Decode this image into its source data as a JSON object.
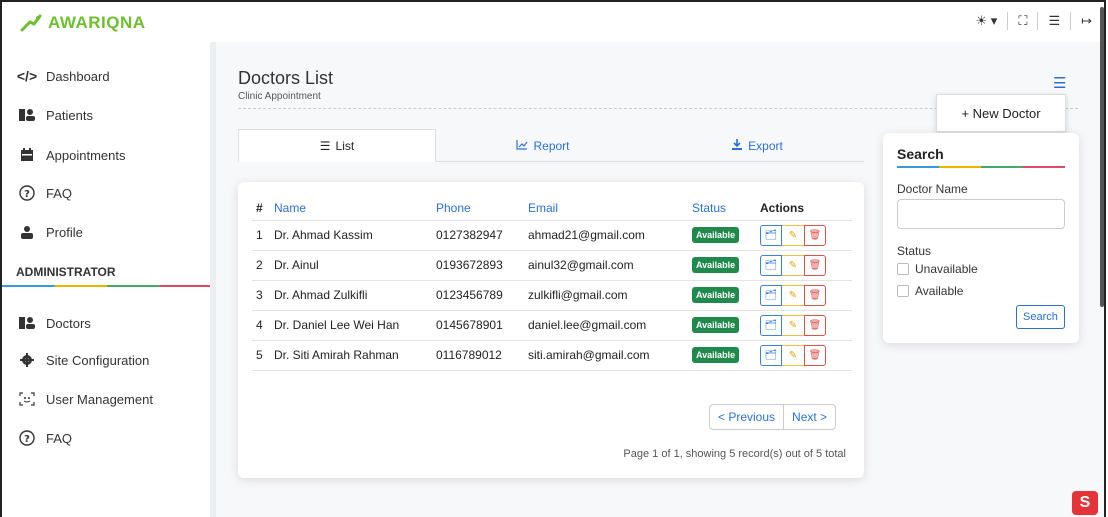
{
  "brand": {
    "name": "AWARIQNA"
  },
  "topbar": {
    "theme_icon": "sun-icon",
    "fullscreen_icon": "fullscreen-icon",
    "menu_icon": "list-icon",
    "logout_icon": "logout-icon"
  },
  "sidebar": {
    "items": [
      {
        "label": "Dashboard",
        "icon": "code-icon"
      },
      {
        "label": "Patients",
        "icon": "users-icon"
      },
      {
        "label": "Appointments",
        "icon": "calendar-icon"
      },
      {
        "label": "FAQ",
        "icon": "question-icon"
      },
      {
        "label": "Profile",
        "icon": "user-icon"
      }
    ],
    "admin_heading": "ADMINISTRATOR",
    "admin_items": [
      {
        "label": "Doctors",
        "icon": "users-icon"
      },
      {
        "label": "Site Configuration",
        "icon": "gear-icon"
      },
      {
        "label": "User Management",
        "icon": "face-scan-icon"
      },
      {
        "label": "FAQ",
        "icon": "question-icon"
      }
    ]
  },
  "page": {
    "title": "Doctors List",
    "subtitle": "Clinic Appointment"
  },
  "new_doctor_button": "+ New Doctor",
  "tabs": [
    {
      "label": "List",
      "icon": "list-icon",
      "active": true
    },
    {
      "label": "Report",
      "icon": "chart-icon",
      "active": false
    },
    {
      "label": "Export",
      "icon": "download-icon",
      "active": false
    }
  ],
  "table": {
    "headers": {
      "num": "#",
      "name": "Name",
      "phone": "Phone",
      "email": "Email",
      "status": "Status",
      "actions": "Actions"
    },
    "rows": [
      {
        "num": "1",
        "name": "Dr. Ahmad Kassim",
        "phone": "0127382947",
        "email": "ahmad21@gmail.com",
        "status": "Available"
      },
      {
        "num": "2",
        "name": "Dr. Ainul",
        "phone": "0193672893",
        "email": "ainul32@gmail.com",
        "status": "Available"
      },
      {
        "num": "3",
        "name": "Dr. Ahmad Zulkifli",
        "phone": "0123456789",
        "email": "zulkifli@gmail.com",
        "status": "Available"
      },
      {
        "num": "4",
        "name": "Dr. Daniel Lee Wei Han",
        "phone": "0145678901",
        "email": "daniel.lee@gmail.com",
        "status": "Available"
      },
      {
        "num": "5",
        "name": "Dr. Siti Amirah Rahman",
        "phone": "0116789012",
        "email": "siti.amirah@gmail.com",
        "status": "Available"
      }
    ]
  },
  "pagination": {
    "prev": "< Previous",
    "next": "Next >",
    "info": "Page 1 of 1, showing 5 record(s) out of 5 total"
  },
  "search": {
    "title": "Search",
    "doctor_name_label": "Doctor Name",
    "doctor_name_value": "",
    "status_label": "Status",
    "options": [
      "Unavailable",
      "Available"
    ],
    "button": "Search"
  },
  "colors": {
    "brand": "#6cbf2e",
    "link": "#2b6fd6",
    "badge": "#1f8a4c"
  }
}
